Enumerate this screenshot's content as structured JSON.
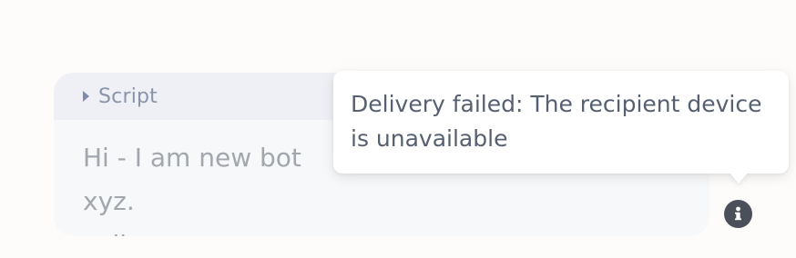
{
  "message": {
    "section_label": "Script",
    "body_text": "Hi - I am new bot xyz.",
    "body_text_continued": "college."
  },
  "status": {
    "icon": "info-icon",
    "tooltip_text": "Delivery failed: The recipient device is unavailable"
  },
  "colors": {
    "page_background": "#fdfcfb",
    "card_background": "#f7f8f9",
    "header_background": "#eef0f5",
    "icon_background": "#4a4f5a",
    "tooltip_text": "#566070"
  }
}
